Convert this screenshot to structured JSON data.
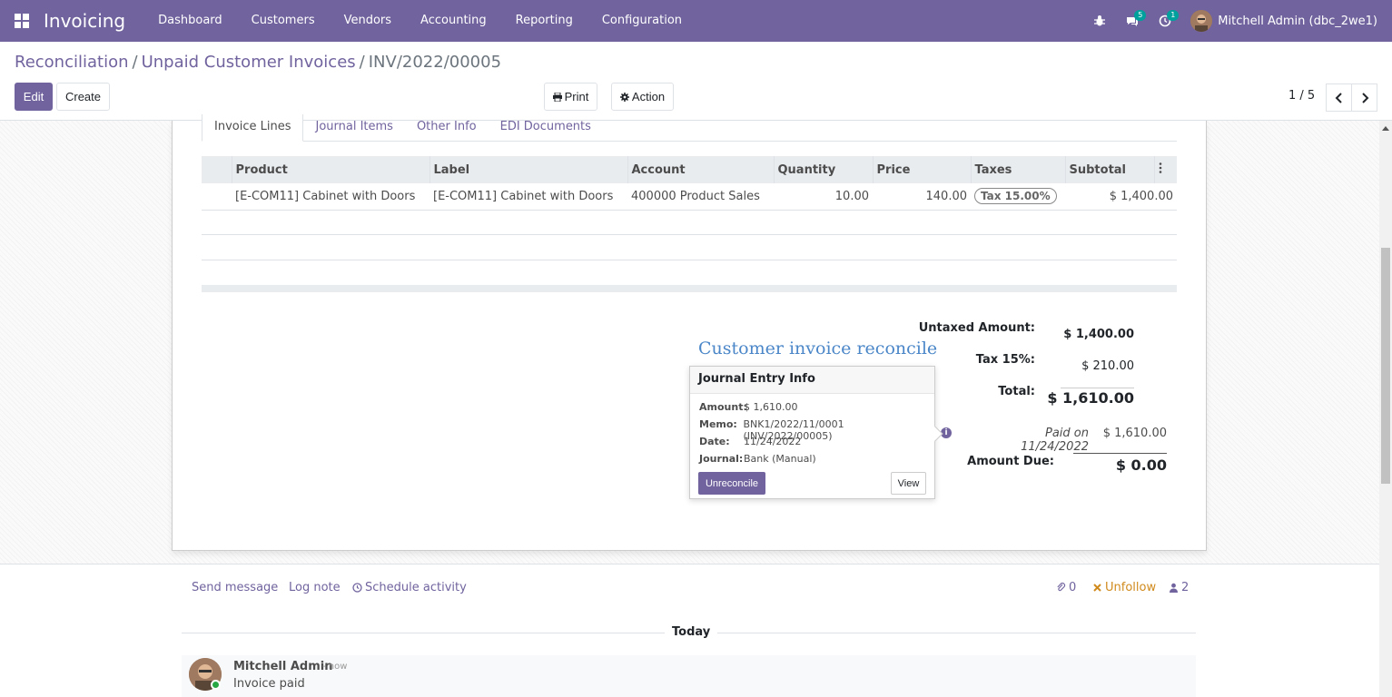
{
  "navbar": {
    "app_name": "Invoicing",
    "menu": [
      "Dashboard",
      "Customers",
      "Vendors",
      "Accounting",
      "Reporting",
      "Configuration"
    ],
    "messages_badge": "5",
    "activities_badge": "1",
    "user": "Mitchell Admin (dbc_2we1)",
    "bg_color": "#71639e"
  },
  "breadcrumb": {
    "item1": "Reconciliation",
    "item2": "Unpaid Customer Invoices",
    "current": "INV/2022/00005"
  },
  "toolbar": {
    "edit": "Edit",
    "create": "Create",
    "print": "Print",
    "action": "Action",
    "pager": "1 / 5"
  },
  "tabs": [
    "Invoice Lines",
    "Journal Items",
    "Other Info",
    "EDI Documents"
  ],
  "lines": {
    "headers": [
      "Product",
      "Label",
      "Account",
      "Quantity",
      "Price",
      "Taxes",
      "Subtotal"
    ],
    "rows": [
      {
        "product": "[E-COM11] Cabinet with Doors",
        "label": "[E-COM11] Cabinet with Doors",
        "account": "400000 Product Sales",
        "quantity": "10.00",
        "price": "140.00",
        "tax": "Tax 15.00%",
        "subtotal": "$ 1,400.00"
      }
    ]
  },
  "totals": {
    "untaxed_label": "Untaxed Amount:",
    "untaxed_value": "$ 1,400.00",
    "tax_label": "Tax 15%:",
    "tax_value": "$ 210.00",
    "total_label": "Total:",
    "total_value": "$ 1,610.00",
    "paid_label": "Paid on 11/24/2022",
    "paid_value": "$ 1,610.00",
    "due_label": "Amount Due:",
    "due_value": "$ 0.00"
  },
  "watermark": "Customer invoice reconcile",
  "popover": {
    "title": "Journal Entry Info",
    "amount_key": "Amount:",
    "amount": "$ 1,610.00",
    "memo_key": "Memo:",
    "memo": "BNK1/2022/11/0001 (INV/2022/00005)",
    "date_key": "Date:",
    "date": "11/24/2022",
    "journal_key": "Journal:",
    "journal": "Bank (Manual)",
    "unreconcile": "Unreconcile",
    "view": "View"
  },
  "chatter": {
    "send_message": "Send message",
    "log_note": "Log note",
    "schedule": "Schedule activity",
    "attachments": "0",
    "unfollow": "Unfollow",
    "followers": "2",
    "today": "Today",
    "author": "Mitchell Admin",
    "time": "- now",
    "body": "Invoice paid"
  }
}
